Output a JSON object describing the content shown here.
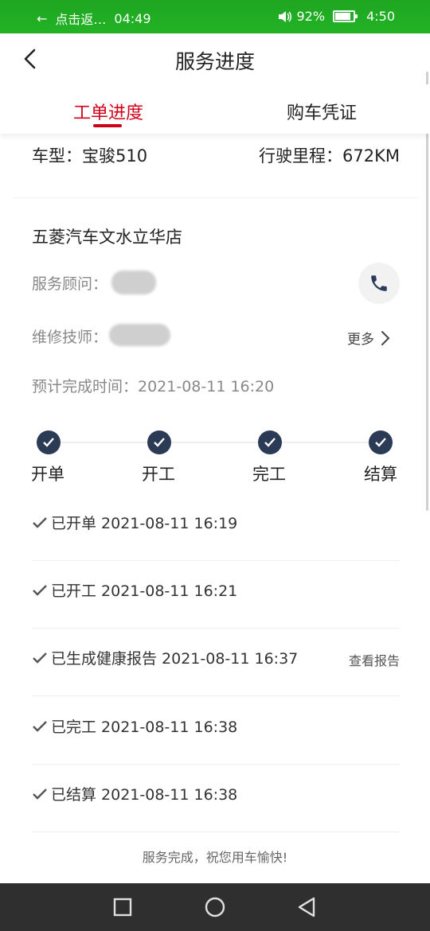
{
  "status_bar": {
    "back_hint": "点击返…",
    "left_time": "04:49",
    "battery": "92%",
    "time": "4:50"
  },
  "header": {
    "title": "服务进度"
  },
  "tabs": [
    {
      "label": "工单进度",
      "active": true
    },
    {
      "label": "购车凭证",
      "active": false
    }
  ],
  "car": {
    "model": "车型：宝骏510",
    "mileage": "行驶里程：672KM"
  },
  "store": {
    "name": "五菱汽车文水立华店",
    "advisor_label": "服务顾问：",
    "technician_label": "维修技师：",
    "more_label": "更多",
    "eta": "预计完成时间：2021-08-11 16:20"
  },
  "steps": [
    {
      "label": "开单",
      "done": true
    },
    {
      "label": "开工",
      "done": true
    },
    {
      "label": "完工",
      "done": true
    },
    {
      "label": "结算",
      "done": true
    }
  ],
  "timeline": [
    {
      "text": "已开单 2021-08-11 16:19"
    },
    {
      "text": "已开工 2021-08-11 16:21"
    },
    {
      "text": "已生成健康报告 2021-08-11 16:37",
      "action": "查看报告"
    },
    {
      "text": "已完工 2021-08-11 16:38"
    },
    {
      "text": "已结算 2021-08-11 16:38"
    }
  ],
  "footer": {
    "message": "服务完成，祝您用车愉快!"
  },
  "colors": {
    "accent": "#d0021b",
    "step": "#2b3a55",
    "status_bar": "#22b324"
  }
}
